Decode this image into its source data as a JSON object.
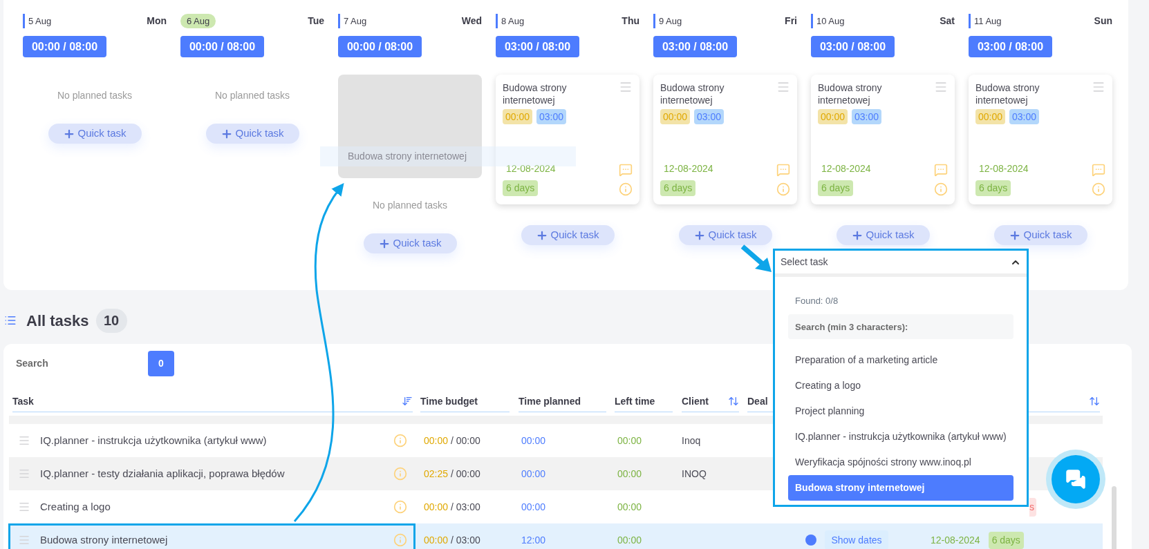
{
  "days": [
    {
      "date": "5 Aug",
      "weekday": "Mon",
      "today": false,
      "time": "00:00 / 08:00",
      "drop_placeholder": false,
      "empty_text": "No planned tasks",
      "quick_task": "Quick task"
    },
    {
      "date": "6 Aug",
      "weekday": "Tue",
      "today": true,
      "time": "00:00 / 08:00",
      "drop_placeholder": false,
      "empty_text": "No planned tasks",
      "quick_task": "Quick task"
    },
    {
      "date": "7 Aug",
      "weekday": "Wed",
      "today": false,
      "time": "00:00 / 08:00",
      "drop_placeholder": true,
      "empty_text": "No planned tasks",
      "quick_task": "Quick task"
    },
    {
      "date": "8 Aug",
      "weekday": "Thu",
      "today": false,
      "time": "03:00 / 08:00",
      "drop_placeholder": false,
      "tasks": [
        {
          "title": "Budowa strony internetowej",
          "spent": "00:00",
          "budget": "03:00",
          "due": "12-08-2024",
          "duration": "6 days"
        }
      ],
      "quick_task": "Quick task"
    },
    {
      "date": "9 Aug",
      "weekday": "Fri",
      "today": false,
      "time": "03:00 / 08:00",
      "drop_placeholder": false,
      "tasks": [
        {
          "title": "Budowa strony internetowej",
          "spent": "00:00",
          "budget": "03:00",
          "due": "12-08-2024",
          "duration": "6 days"
        }
      ],
      "quick_task": "Quick task"
    },
    {
      "date": "10 Aug",
      "weekday": "Sat",
      "today": false,
      "time": "03:00 / 08:00",
      "drop_placeholder": false,
      "tasks": [
        {
          "title": "Budowa strony internetowej",
          "spent": "00:00",
          "budget": "03:00",
          "due": "12-08-2024",
          "duration": "6 days"
        }
      ],
      "quick_task": "Quick task"
    },
    {
      "date": "11 Aug",
      "weekday": "Sun",
      "today": false,
      "time": "03:00 / 08:00",
      "drop_placeholder": false,
      "tasks": [
        {
          "title": "Budowa strony internetowej",
          "spent": "00:00",
          "budget": "03:00",
          "due": "12-08-2024",
          "duration": "6 days"
        }
      ],
      "quick_task": "Quick task"
    }
  ],
  "drag_preview": {
    "title": "Budowa strony internetowej"
  },
  "all_tasks": {
    "title": "All tasks",
    "count": "10"
  },
  "search": {
    "label": "Search",
    "count": "0"
  },
  "table": {
    "columns": [
      {
        "label": "Task",
        "kind": "sortdesc"
      },
      {
        "label": "Time budget",
        "kind": "plain"
      },
      {
        "label": "Time planned",
        "kind": "plain"
      },
      {
        "label": "Left time",
        "kind": "plain"
      },
      {
        "label": "Client",
        "kind": "sortable"
      },
      {
        "label": "Deal",
        "kind": "sortable"
      }
    ],
    "rows": [
      {
        "task": "IQ.planner - instrukcja użytkownika (artykuł www)",
        "spent": "00:00",
        "budget": "/ 00:00",
        "planned": "00:00",
        "left": "00:00",
        "client": "Inoq",
        "selected": false,
        "hovered": false
      },
      {
        "task": "IQ.planner - testy działania aplikacji, poprawa błędów",
        "spent": "02:25",
        "budget": "/ 00:00",
        "planned": "00:00",
        "left": "00:00",
        "client": "INOQ",
        "selected": false,
        "hovered": true
      },
      {
        "task": "Creating a logo",
        "spent": "00:00",
        "budget": "/ 03:00",
        "planned": "00:00",
        "left": "00:00",
        "selected": false,
        "hovered": false,
        "tag": "s"
      },
      {
        "task": "Budowa strony internetowej",
        "spent": "00:00",
        "budget": "/ 03:00",
        "planned": "12:00",
        "left": "00:00",
        "selected": true,
        "hovered": false,
        "color": "#4d7cfe",
        "dates_button": "Show dates",
        "due": "12-08-2024",
        "duration": "6 days"
      }
    ]
  },
  "task_select": {
    "label": "Select task",
    "expanded": true,
    "found": "Found: 0/8",
    "search_placeholder": "Search (min 3 characters):",
    "options": [
      {
        "label": "Preparation of a marketing article",
        "selected": false
      },
      {
        "label": "Creating a logo",
        "selected": false
      },
      {
        "label": "Project planning",
        "selected": false
      },
      {
        "label": "IQ.planner - instrukcja użytkownika (artykuł www)",
        "selected": false
      },
      {
        "label": "Weryfikacja spójności strony www.inoq.pl",
        "selected": false
      },
      {
        "label": "Budowa strony internetowej",
        "selected": true
      }
    ]
  }
}
